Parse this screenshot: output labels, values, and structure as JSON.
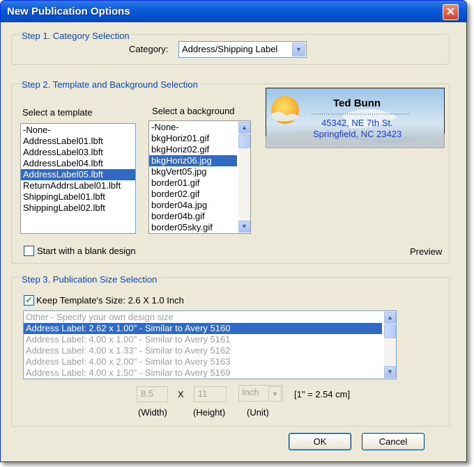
{
  "window": {
    "title": "New Publication Options",
    "close_label": "✕"
  },
  "step1": {
    "group_label": "Step 1. Category Selection",
    "category_label": "Category:",
    "category_value": "Address/Shipping Label"
  },
  "step2": {
    "group_label": "Step 2. Template and Background Selection",
    "template_label": "Select a template",
    "templates": [
      "-None-",
      "AddressLabel01.lbft",
      "AddressLabel03.lbft",
      "AddressLabel04.lbft",
      "AddressLabel05.lbft",
      "ReturnAddrsLabel01.lbft",
      "ShippingLabel01.lbft",
      "ShippingLabel02.lbft"
    ],
    "selected_template": "AddressLabel05.lbft",
    "background_label": "Select a background",
    "backgrounds": [
      "-None-",
      "bkgHoriz01.gif",
      "bkgHoriz02.gif",
      "bkgHoriz06.jpg",
      "bkgVert05.jpg",
      "border01.gif",
      "border02.gif",
      "border04a.jpg",
      "border04b.gif",
      "border05sky.gif"
    ],
    "selected_background": "bkgHoriz06.jpg",
    "blank_design_label": "Start with a blank design",
    "blank_design_checked": false,
    "preview_label": "Preview",
    "preview": {
      "name": "Ted Bunn",
      "line1": "45342, NE 7th St.",
      "line2": "Springfield, NC 23423"
    }
  },
  "step3": {
    "group_label": "Step 3. Publication Size Selection",
    "keep_size_label": "Keep Template's Size: 2.6 X 1.0 Inch",
    "keep_size_checked": true,
    "sizes": [
      "Other - Specify your own design size",
      "Address Label: 2.62 x 1.00\" - Similar to Avery 5160",
      "Address Label: 4.00 x 1.00\" - Similar to Avery 5161",
      "Address Label: 4.00 x 1.33\" - Similar to Avery 5162",
      "Address Label: 4.00 x 2.00\" - Similar to Avery 5163",
      "Address Label: 4.00 x 1.50\" - Similar to Avery 5169"
    ],
    "selected_size": "Address Label: 2.62 x 1.00\" - Similar to Avery 5160",
    "width_value": "8.5",
    "x_label": "X",
    "height_value": "11",
    "unit_value": "Inch",
    "conversion_note": "[1\" = 2.54 cm]",
    "width_label": "(Width)",
    "height_label": "(Height)",
    "unit_label": "(Unit)"
  },
  "buttons": {
    "ok": "OK",
    "cancel": "Cancel"
  }
}
